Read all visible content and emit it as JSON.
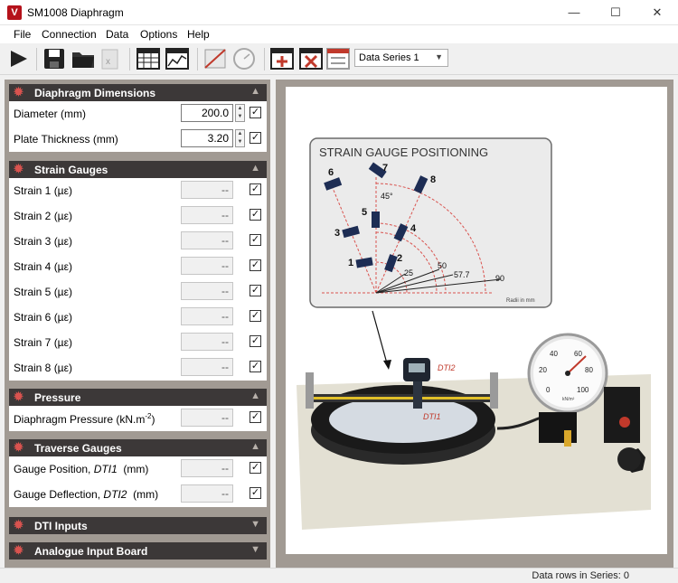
{
  "window": {
    "title": "SM1008 Diaphragm",
    "icon_letter": "V",
    "minimize_glyph": "—",
    "maximize_glyph": "☐",
    "close_glyph": "✕"
  },
  "menu": [
    "File",
    "Connection",
    "Data",
    "Options",
    "Help"
  ],
  "toolbar": {
    "icons": [
      "play-icon",
      "save-icon",
      "open-folder-icon",
      "excel-export-icon",
      "table-view-icon",
      "chart-view-icon",
      "zero-calibrate-icon",
      "gauge-icon",
      "add-series-icon",
      "delete-series-icon",
      "clear-series-icon"
    ],
    "series_select": "Data Series 1"
  },
  "sections": {
    "dimensions": {
      "title": "Diaphragm Dimensions",
      "rows": [
        {
          "label": "Diameter  (mm)",
          "value": "200.0",
          "checked": true
        },
        {
          "label": "Plate Thickness  (mm)",
          "value": "3.20",
          "checked": true
        }
      ]
    },
    "strain": {
      "title": "Strain Gauges",
      "rows": [
        {
          "label": "Strain 1  (µε)",
          "value": "--",
          "checked": true
        },
        {
          "label": "Strain 2  (µε)",
          "value": "--",
          "checked": true
        },
        {
          "label": "Strain 3  (µε)",
          "value": "--",
          "checked": true
        },
        {
          "label": "Strain 4  (µε)",
          "value": "--",
          "checked": true
        },
        {
          "label": "Strain 5  (µε)",
          "value": "--",
          "checked": true
        },
        {
          "label": "Strain 6  (µε)",
          "value": "--",
          "checked": true
        },
        {
          "label": "Strain 7  (µε)",
          "value": "--",
          "checked": true
        },
        {
          "label": "Strain 8  (µε)",
          "value": "--",
          "checked": true
        }
      ]
    },
    "pressure": {
      "title": "Pressure",
      "rows": [
        {
          "label": "Diaphragm Pressure  (kN.m",
          "sup": "-2",
          "tail": ")",
          "value": "--",
          "checked": true
        }
      ]
    },
    "traverse": {
      "title": "Traverse Gauges",
      "rows": [
        {
          "label": "Gauge Position, ",
          "ital": "DTI1",
          "tail": "  (mm)",
          "value": "--",
          "checked": true
        },
        {
          "label": "Gauge Deflection, ",
          "ital": "DTI2",
          "tail": "  (mm)",
          "value": "--",
          "checked": true
        }
      ]
    },
    "dti": {
      "title": "DTI Inputs"
    },
    "analogue": {
      "title": "Analogue Input Board"
    }
  },
  "diagram": {
    "panel_title": "STRAIN GAUGE POSITIONING",
    "gauge_labels": [
      "1",
      "2",
      "3",
      "4",
      "5",
      "6",
      "7",
      "8"
    ],
    "angle_label": "45°",
    "radii_labels": [
      "25",
      "50",
      "57.7",
      "90"
    ],
    "radii_unit": "Radii in mm",
    "dti2_label": "DTI2",
    "dti1_label": "DTI1",
    "pressure_gauge_ticks": [
      "0",
      "20",
      "40",
      "60",
      "80",
      "100"
    ],
    "pressure_gauge_unit": "kN/m²"
  },
  "status": {
    "text": "Data rows in Series: 0"
  }
}
